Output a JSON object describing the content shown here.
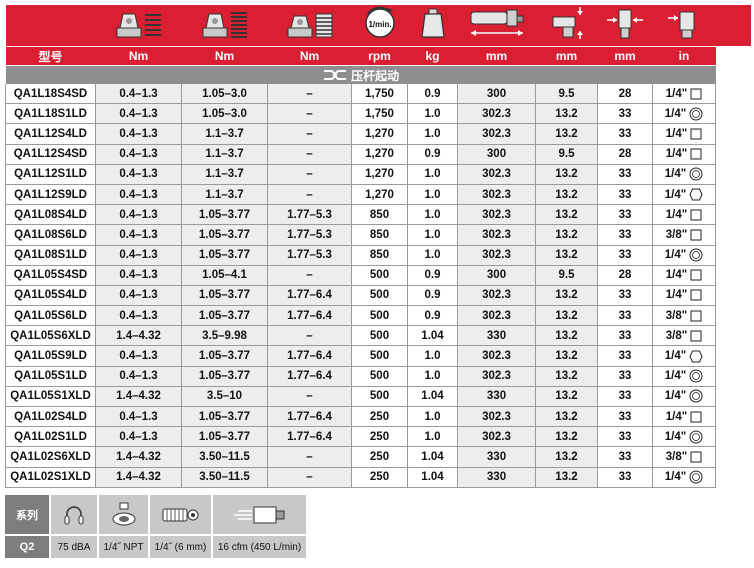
{
  "units": {
    "model": "型号",
    "torque1": "Nm",
    "torque2": "Nm",
    "torque3": "Nm",
    "speed": "rpm",
    "weight": "kg",
    "length": "mm",
    "dim_a": "mm",
    "dim_b": "mm",
    "drive": "in"
  },
  "icons": {
    "torque1": "nut-spring-light-icon",
    "torque2": "nut-spring-medium-icon",
    "torque3": "nut-spring-heavy-icon",
    "speed": "1-min-speed-icon",
    "speed_text": "1/min.",
    "weight": "weight-icon",
    "length": "tool-length-icon",
    "dim_a": "angle-head-height-icon",
    "dim_b": "angle-head-width-icon",
    "drive": "angle-drive-icon",
    "section": "lever-start-icon"
  },
  "section_label": "压杆起动",
  "rows": [
    {
      "model": "QA1L18S4SD",
      "t1": "0.4–1.3",
      "t2": "1.05–3.0",
      "t3": "–",
      "rpm": "1,750",
      "kg": "0.9",
      "len": "300",
      "a": "9.5",
      "b": "28",
      "drive": "1/4\"",
      "shape": "square"
    },
    {
      "model": "QA1L18S1LD",
      "t1": "0.4–1.3",
      "t2": "1.05–3.0",
      "t3": "–",
      "rpm": "1,750",
      "kg": "1.0",
      "len": "302.3",
      "a": "13.2",
      "b": "33",
      "drive": "1/4\"",
      "shape": "round"
    },
    {
      "model": "QA1L12S4LD",
      "t1": "0.4–1.3",
      "t2": "1.1–3.7",
      "t3": "–",
      "rpm": "1,270",
      "kg": "1.0",
      "len": "302.3",
      "a": "13.2",
      "b": "33",
      "drive": "1/4\"",
      "shape": "square"
    },
    {
      "model": "QA1L12S4SD",
      "t1": "0.4–1.3",
      "t2": "1.1–3.7",
      "t3": "–",
      "rpm": "1,270",
      "kg": "0.9",
      "len": "300",
      "a": "9.5",
      "b": "28",
      "drive": "1/4\"",
      "shape": "square"
    },
    {
      "model": "QA1L12S1LD",
      "t1": "0.4–1.3",
      "t2": "1.1–3.7",
      "t3": "–",
      "rpm": "1,270",
      "kg": "1.0",
      "len": "302.3",
      "a": "13.2",
      "b": "33",
      "drive": "1/4\"",
      "shape": "round"
    },
    {
      "model": "QA1L12S9LD",
      "t1": "0.4–1.3",
      "t2": "1.1–3.7",
      "t3": "–",
      "rpm": "1,270",
      "kg": "1.0",
      "len": "302.3",
      "a": "13.2",
      "b": "33",
      "drive": "1/4\"",
      "shape": "hex"
    },
    {
      "model": "QA1L08S4LD",
      "t1": "0.4–1.3",
      "t2": "1.05–3.77",
      "t3": "1.77–5.3",
      "rpm": "850",
      "kg": "1.0",
      "len": "302.3",
      "a": "13.2",
      "b": "33",
      "drive": "1/4\"",
      "shape": "square"
    },
    {
      "model": "QA1L08S6LD",
      "t1": "0.4–1.3",
      "t2": "1.05–3.77",
      "t3": "1.77–5.3",
      "rpm": "850",
      "kg": "1.0",
      "len": "302.3",
      "a": "13.2",
      "b": "33",
      "drive": "3/8\"",
      "shape": "square"
    },
    {
      "model": "QA1L08S1LD",
      "t1": "0.4–1.3",
      "t2": "1.05–3.77",
      "t3": "1.77–5.3",
      "rpm": "850",
      "kg": "1.0",
      "len": "302.3",
      "a": "13.2",
      "b": "33",
      "drive": "1/4\"",
      "shape": "round"
    },
    {
      "model": "QA1L05S4SD",
      "t1": "0.4–1.3",
      "t2": "1.05–4.1",
      "t3": "–",
      "rpm": "500",
      "kg": "0.9",
      "len": "300",
      "a": "9.5",
      "b": "28",
      "drive": "1/4\"",
      "shape": "square"
    },
    {
      "model": "QA1L05S4LD",
      "t1": "0.4–1.3",
      "t2": "1.05–3.77",
      "t3": "1.77–6.4",
      "rpm": "500",
      "kg": "0.9",
      "len": "302.3",
      "a": "13.2",
      "b": "33",
      "drive": "1/4\"",
      "shape": "square"
    },
    {
      "model": "QA1L05S6LD",
      "t1": "0.4–1.3",
      "t2": "1.05–3.77",
      "t3": "1.77–6.4",
      "rpm": "500",
      "kg": "0.9",
      "len": "302.3",
      "a": "13.2",
      "b": "33",
      "drive": "3/8\"",
      "shape": "square"
    },
    {
      "model": "QA1L05S6XLD",
      "t1": "1.4–4.32",
      "t2": "3.5–9.98",
      "t3": "–",
      "rpm": "500",
      "kg": "1.04",
      "len": "330",
      "a": "13.2",
      "b": "33",
      "drive": "3/8\"",
      "shape": "square"
    },
    {
      "model": "QA1L05S9LD",
      "t1": "0.4–1.3",
      "t2": "1.05–3.77",
      "t3": "1.77–6.4",
      "rpm": "500",
      "kg": "1.0",
      "len": "302.3",
      "a": "13.2",
      "b": "33",
      "drive": "1/4\"",
      "shape": "hex"
    },
    {
      "model": "QA1L05S1LD",
      "t1": "0.4–1.3",
      "t2": "1.05–3.77",
      "t3": "1.77–6.4",
      "rpm": "500",
      "kg": "1.0",
      "len": "302.3",
      "a": "13.2",
      "b": "33",
      "drive": "1/4\"",
      "shape": "round"
    },
    {
      "model": "QA1L05S1XLD",
      "t1": "1.4–4.32",
      "t2": "3.5–10",
      "t3": "–",
      "rpm": "500",
      "kg": "1.04",
      "len": "330",
      "a": "13.2",
      "b": "33",
      "drive": "1/4\"",
      "shape": "round"
    },
    {
      "model": "QA1L02S4LD",
      "t1": "0.4–1.3",
      "t2": "1.05–3.77",
      "t3": "1.77–6.4",
      "rpm": "250",
      "kg": "1.0",
      "len": "302.3",
      "a": "13.2",
      "b": "33",
      "drive": "1/4\"",
      "shape": "square"
    },
    {
      "model": "QA1L02S1LD",
      "t1": "0.4–1.3",
      "t2": "1.05–3.77",
      "t3": "1.77–6.4",
      "rpm": "250",
      "kg": "1.0",
      "len": "302.3",
      "a": "13.2",
      "b": "33",
      "drive": "1/4\"",
      "shape": "round"
    },
    {
      "model": "QA1L02S6XLD",
      "t1": "1.4–4.32",
      "t2": "3.50–11.5",
      "t3": "–",
      "rpm": "250",
      "kg": "1.04",
      "len": "330",
      "a": "13.2",
      "b": "33",
      "drive": "3/8\"",
      "shape": "square"
    },
    {
      "model": "QA1L02S1XLD",
      "t1": "1.4–4.32",
      "t2": "3.50–11.5",
      "t3": "–",
      "rpm": "250",
      "kg": "1.04",
      "len": "330",
      "a": "13.2",
      "b": "33",
      "drive": "1/4\"",
      "shape": "round"
    }
  ],
  "features": {
    "label_top": "系列",
    "label_bottom": "Q2",
    "noise": "75 dBA",
    "inlet": "1/4˝ NPT",
    "hose": "1/4˝ (6 mm)",
    "air": "16 cfm (450 L/min)",
    "icons": [
      "ear-protection-icon",
      "air-inlet-icon",
      "hose-icon",
      "air-flow-icon"
    ]
  },
  "colors": {
    "header_red": "#da1f33",
    "section_gray": "#8e8e8e",
    "zebra": "#ededed"
  }
}
